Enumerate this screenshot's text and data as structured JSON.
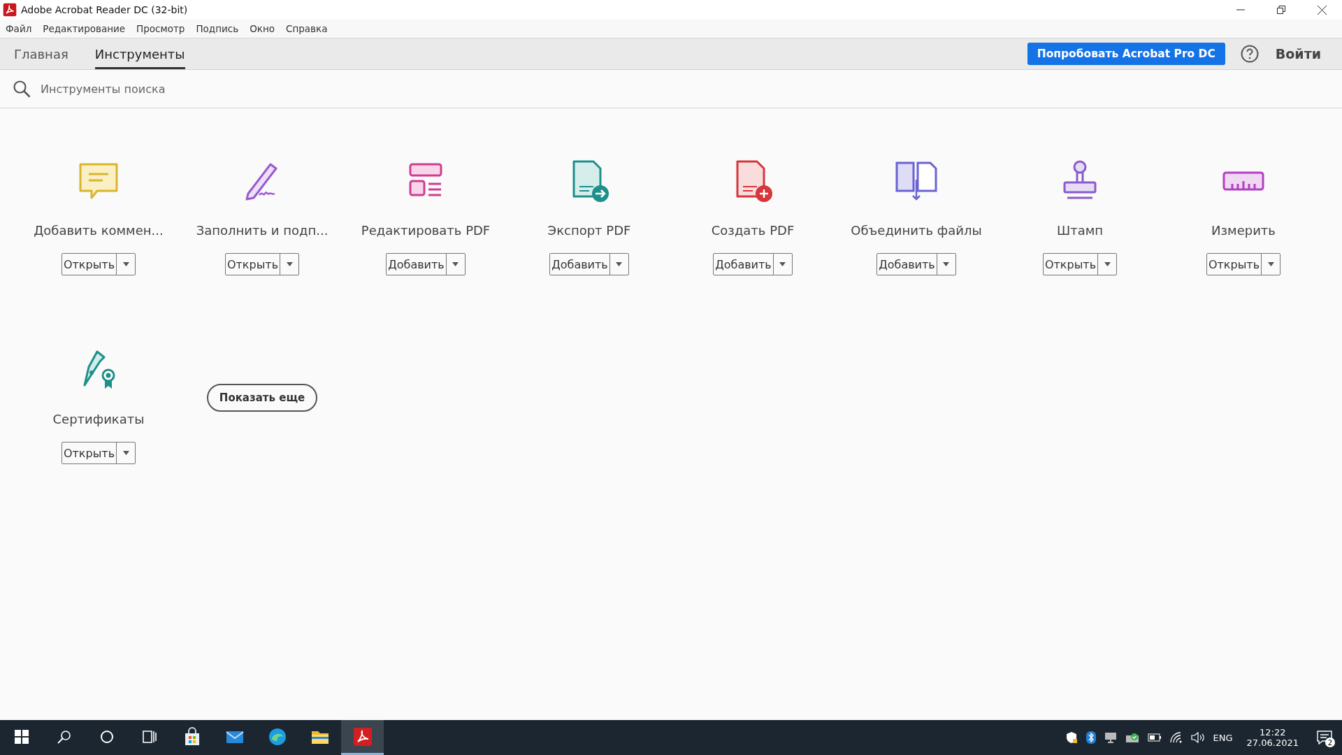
{
  "window": {
    "title": "Adobe Acrobat Reader DC (32-bit)"
  },
  "menu": [
    "Файл",
    "Редактирование",
    "Просмотр",
    "Подпись",
    "Окно",
    "Справка"
  ],
  "tabs": [
    {
      "label": "Главная",
      "selected": false
    },
    {
      "label": "Инструменты",
      "selected": true
    }
  ],
  "try_button": "Попробовать Acrobat Pro DC",
  "sign_in": "Войти",
  "search": {
    "placeholder": "Инструменты поиска"
  },
  "tools": [
    {
      "kind": "comment",
      "label": "Добавить коммен...",
      "action": "Открыть"
    },
    {
      "kind": "fill-sign",
      "label": "Заполнить и подп...",
      "action": "Открыть"
    },
    {
      "kind": "edit",
      "label": "Редактировать PDF",
      "action": "Добавить"
    },
    {
      "kind": "export",
      "label": "Экспорт PDF",
      "action": "Добавить"
    },
    {
      "kind": "create",
      "label": "Создать PDF",
      "action": "Добавить"
    },
    {
      "kind": "combine",
      "label": "Объединить файлы",
      "action": "Добавить"
    },
    {
      "kind": "stamp",
      "label": "Штамп",
      "action": "Открыть"
    },
    {
      "kind": "measure",
      "label": "Измерить",
      "action": "Открыть"
    },
    {
      "kind": "certificate",
      "label": "Сертификаты",
      "action": "Открыть"
    }
  ],
  "show_more": "Показать еще",
  "taskbar": {
    "apps": [
      {
        "kind": "store",
        "selected": false
      },
      {
        "kind": "mail",
        "selected": false
      },
      {
        "kind": "edge",
        "selected": false
      },
      {
        "kind": "explorer",
        "selected": false
      },
      {
        "kind": "acrobat",
        "selected": true
      }
    ],
    "language": "ENG",
    "time": "12:22",
    "date": "27.06.2021",
    "notifications": "2"
  }
}
